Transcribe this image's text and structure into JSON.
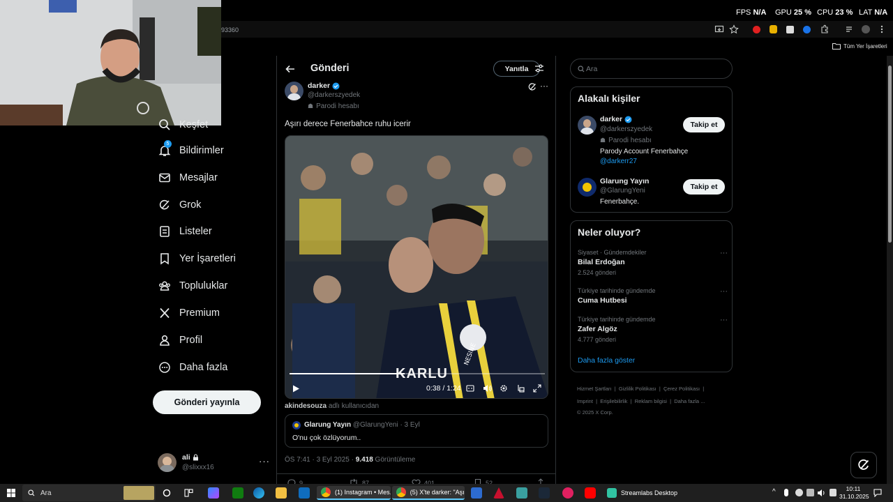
{
  "overlay": {
    "fps_label": "FPS",
    "fps_value": "N/A",
    "gpu_label": "GPU",
    "gpu_value": "25 %",
    "cpu_label": "CPU",
    "cpu_value": "23 %",
    "lat_label": "LAT",
    "lat_value": "N/A"
  },
  "browser": {
    "url_fragment": "93360",
    "bookmarks_label": "Tüm Yer İşaretleri"
  },
  "nav": {
    "items": [
      {
        "label": "Keşfet",
        "icon": "search-icon"
      },
      {
        "label": "Bildirimler",
        "icon": "bell-icon",
        "badge": "5"
      },
      {
        "label": "Mesajlar",
        "icon": "mail-icon"
      },
      {
        "label": "Grok",
        "icon": "grok-icon"
      },
      {
        "label": "Listeler",
        "icon": "list-icon"
      },
      {
        "label": "Yer İşaretleri",
        "icon": "bookmark-icon"
      },
      {
        "label": "Topluluklar",
        "icon": "communities-icon"
      },
      {
        "label": "Premium",
        "icon": "x-logo-icon"
      },
      {
        "label": "Profil",
        "icon": "person-icon"
      },
      {
        "label": "Daha fazla",
        "icon": "more-circle-icon"
      }
    ],
    "post_button": "Gönderi yayınla",
    "account": {
      "name": "ali",
      "handle": "@slixxx16"
    }
  },
  "post": {
    "header_title": "Gönderi",
    "reply_button": "Yanıtla",
    "author_name": "darker",
    "author_handle": "@darkerszyedek",
    "parody_label": "Parodi hesabı",
    "text": "Aşırı derece Fenerbahce ruhu icerir",
    "video": {
      "caption": "KARLU",
      "time": "0:38 / 1:24",
      "progress": 0.45
    },
    "attribution_user": "akindesouza",
    "attribution_suffix": "adlı kullanıcıdan",
    "quote": {
      "name": "Glarung Yayın",
      "handle": "@GlarungYeni",
      "date": "· 3 Eyl",
      "text": "O'nu çok özlüyorum.."
    },
    "meta_time": "ÖS 7:41 · 3 Eyl 2025 ·",
    "views_count": "9.418",
    "views_label": "Görüntüleme",
    "action_counts": [
      "9",
      "87",
      "401",
      "52"
    ]
  },
  "sidebar": {
    "search_placeholder": "Ara",
    "relevant": {
      "title": "Alakalı kişiler",
      "people": [
        {
          "name": "darker",
          "handle": "@darkerszyedek",
          "parody": "Parodi hesabı",
          "bio": "Parody Account Fenerbahçe",
          "bio_link": "@darkerr27",
          "button": "Takip et"
        },
        {
          "name": "Glarung Yayın",
          "handle": "@GlarungYeni",
          "bio": "Fenerbahçe.",
          "button": "Takip et"
        }
      ]
    },
    "trends": {
      "title": "Neler oluyor?",
      "items": [
        {
          "context": "Siyaset · Gündemdekiler",
          "name": "Bilal Erdoğan",
          "count": "2.524 gönderi"
        },
        {
          "context": "Türkiye tarihinde gündemde",
          "name": "Cuma Hutbesi",
          "count": ""
        },
        {
          "context": "Türkiye tarihinde gündemde",
          "name": "Zafer Algöz",
          "count": "4.777 gönderi"
        }
      ],
      "show_more": "Daha fazla göster"
    },
    "footer": {
      "links": [
        "Hizmet Şartları",
        "Gizlilik Politikası",
        "Çerez Politikası",
        "Imprint",
        "Erişilebilirlik",
        "Reklam bilgisi",
        "Daha fazla ..."
      ],
      "copyright": "© 2025 X Corp."
    }
  },
  "taskbar": {
    "search_placeholder": "Ara",
    "task_instagram": "(1) Instagram • Mes...",
    "task_x": "(5) X'te darker: \"Aşı...",
    "task_streamlabs": "Streamlabs Desktop",
    "time": "10:11",
    "date": "31.10.2025"
  },
  "colors": {
    "accent": "#1d9bf0",
    "background": "#000000",
    "border": "#2f3336",
    "muted": "#71767b"
  }
}
